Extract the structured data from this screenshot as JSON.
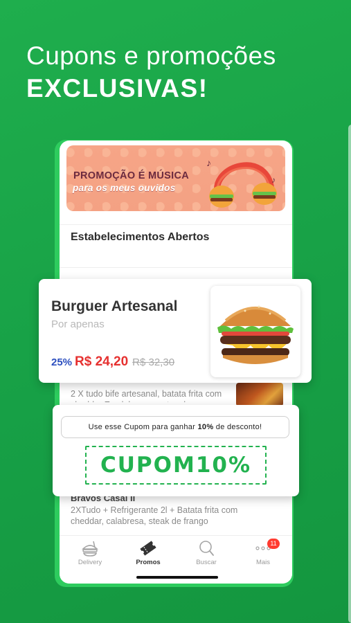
{
  "headline": {
    "line1": "Cupons e promoções",
    "line2": "EXCLUSIVAS!"
  },
  "banner": {
    "line1": "PROMOÇÃO É MÚSICA",
    "line2": "para os meus ouvidos"
  },
  "section_title": "Estabelecimentos Abertos",
  "featured": {
    "name": "Burguer Artesanal",
    "subtitle": "Por apenas",
    "discount": "25%",
    "price": "R$ 24,20",
    "old_price": "R$ 32,30"
  },
  "listing": [
    {
      "title": "",
      "description": "2 X tudo bife artesanal, batata frita com cheddar E calabresa pontos de"
    },
    {
      "title": "Bravos Casal II",
      "description": "2XTudo + Refrigerante 2l + Batata frita com cheddar, calabresa, steak de frango"
    }
  ],
  "coupon": {
    "note_prefix": "Use esse Cupom para ganhar",
    "note_bold": "10%",
    "note_suffix": "de desconto!",
    "code": "CUPOM10%"
  },
  "tabbar": {
    "items": [
      {
        "label": "Delivery",
        "icon": "food-icon",
        "active": false
      },
      {
        "label": "Promos",
        "icon": "ticket-icon",
        "active": true
      },
      {
        "label": "Buscar",
        "icon": "search-icon",
        "active": false
      },
      {
        "label": "Mais",
        "icon": "more-icon",
        "active": false,
        "badge": "11"
      }
    ]
  },
  "colors": {
    "background": "#17a046",
    "accent": "#22b24f",
    "price": "#e6302f",
    "discount": "#2c4fbf"
  }
}
